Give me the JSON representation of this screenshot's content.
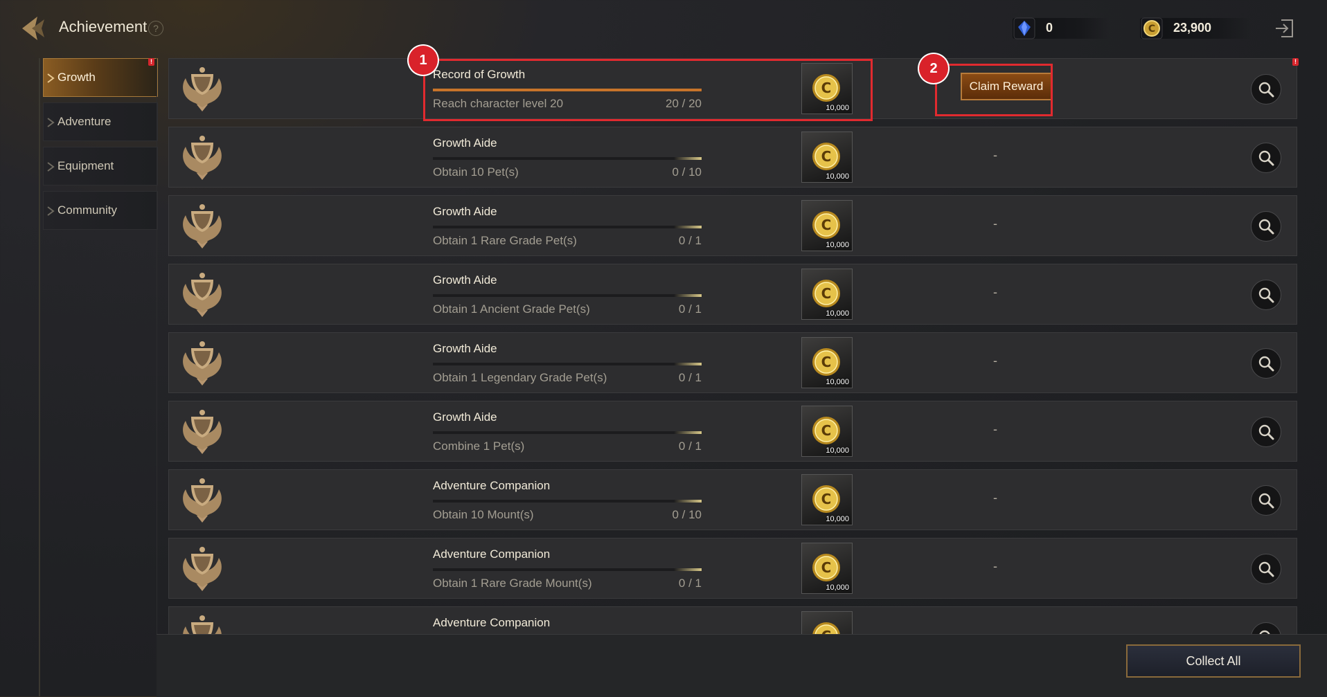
{
  "header": {
    "title": "Achievement",
    "help_glyph": "?",
    "gems": {
      "icon": "blue-gem-icon",
      "value": "0"
    },
    "coins": {
      "icon": "gold-coin-icon",
      "value": "23,900"
    }
  },
  "sidebar": {
    "items": [
      {
        "label": "Growth",
        "active": true,
        "badge": "!"
      },
      {
        "label": "Adventure",
        "active": false
      },
      {
        "label": "Equipment",
        "active": false
      },
      {
        "label": "Community",
        "active": false
      }
    ]
  },
  "list_badge": "!",
  "callouts": {
    "first": "1",
    "second": "2"
  },
  "achievements": [
    {
      "title": "Record of Growth",
      "desc": "Reach character level 20",
      "progress": "20 / 20",
      "fraction": 1.0,
      "reward": "10,000",
      "status": "",
      "claim_label": "Claim Reward"
    },
    {
      "title": "Growth Aide",
      "desc": "Obtain 10 Pet(s)",
      "progress": "0 / 10",
      "fraction": 0.0,
      "reward": "10,000",
      "status": "-"
    },
    {
      "title": "Growth Aide",
      "desc": "Obtain 1 Rare Grade Pet(s)",
      "progress": "0 / 1",
      "fraction": 0.0,
      "reward": "10,000",
      "status": "-"
    },
    {
      "title": "Growth Aide",
      "desc": "Obtain 1 Ancient Grade Pet(s)",
      "progress": "0 / 1",
      "fraction": 0.0,
      "reward": "10,000",
      "status": "-"
    },
    {
      "title": "Growth Aide",
      "desc": "Obtain 1 Legendary Grade Pet(s)",
      "progress": "0 / 1",
      "fraction": 0.0,
      "reward": "10,000",
      "status": "-"
    },
    {
      "title": "Growth Aide",
      "desc": "Combine 1 Pet(s)",
      "progress": "0 / 1",
      "fraction": 0.0,
      "reward": "10,000",
      "status": "-"
    },
    {
      "title": "Adventure Companion",
      "desc": "Obtain 10 Mount(s)",
      "progress": "0 / 10",
      "fraction": 0.0,
      "reward": "10,000",
      "status": "-"
    },
    {
      "title": "Adventure Companion",
      "desc": "Obtain 1 Rare Grade Mount(s)",
      "progress": "0 / 1",
      "fraction": 0.0,
      "reward": "10,000",
      "status": "-"
    },
    {
      "title": "Adventure Companion",
      "desc": "",
      "progress": "",
      "fraction": 0.0,
      "reward": "",
      "status": ""
    }
  ],
  "footer": {
    "collect_all_label": "Collect All"
  },
  "colors": {
    "accent": "#d9222a",
    "progress_complete": "#c8742a",
    "progress_tick": "#d8c888"
  }
}
